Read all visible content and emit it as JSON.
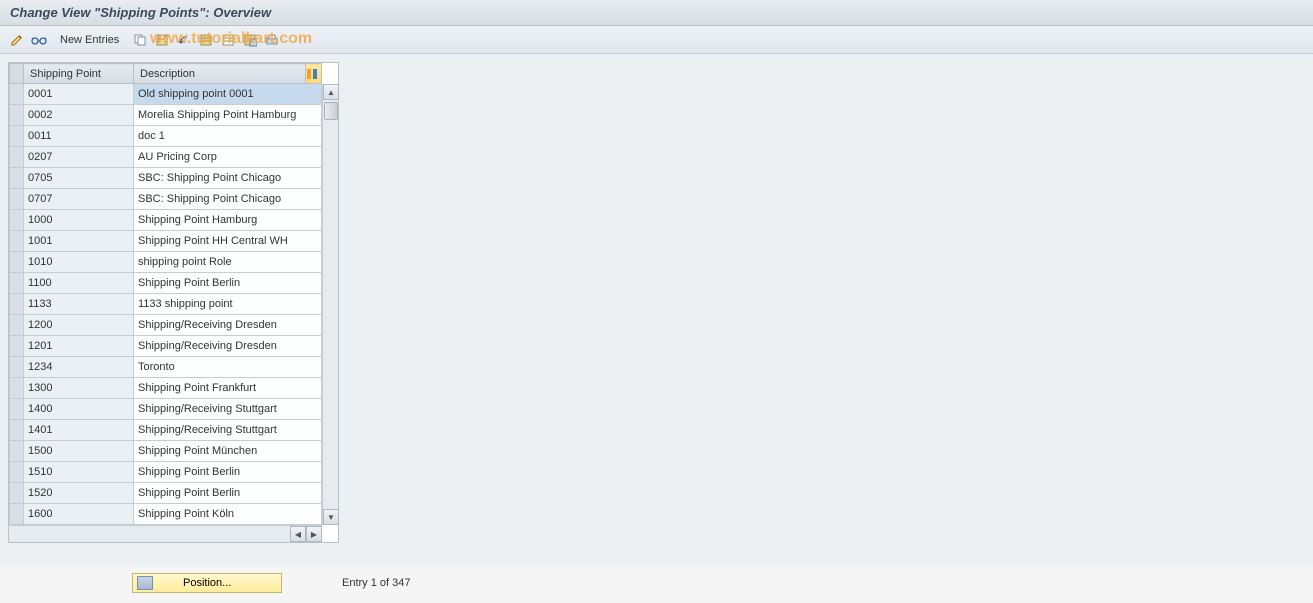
{
  "title": "Change View \"Shipping Points\": Overview",
  "toolbar": {
    "new_entries_label": "New Entries"
  },
  "watermark": "www.tutorialkart.com",
  "table": {
    "headers": {
      "shipping_point": "Shipping Point",
      "description": "Description"
    },
    "rows": [
      {
        "sp": "0001",
        "desc": "Old shipping point 0001"
      },
      {
        "sp": "0002",
        "desc": "Morelia Shipping Point Hamburg"
      },
      {
        "sp": "0011",
        "desc": "doc 1"
      },
      {
        "sp": "0207",
        "desc": "AU Pricing Corp"
      },
      {
        "sp": "0705",
        "desc": "SBC: Shipping Point Chicago"
      },
      {
        "sp": "0707",
        "desc": "SBC: Shipping Point Chicago"
      },
      {
        "sp": "1000",
        "desc": "Shipping Point Hamburg"
      },
      {
        "sp": "1001",
        "desc": "Shipping Point HH Central WH"
      },
      {
        "sp": "1010",
        "desc": "shipping point Role"
      },
      {
        "sp": "1100",
        "desc": "Shipping Point Berlin"
      },
      {
        "sp": "1133",
        "desc": "1133 shipping point"
      },
      {
        "sp": "1200",
        "desc": "Shipping/Receiving Dresden"
      },
      {
        "sp": "1201",
        "desc": "Shipping/Receiving Dresden"
      },
      {
        "sp": "1234",
        "desc": "Toronto"
      },
      {
        "sp": "1300",
        "desc": "Shipping Point Frankfurt"
      },
      {
        "sp": "1400",
        "desc": "Shipping/Receiving Stuttgart"
      },
      {
        "sp": "1401",
        "desc": "Shipping/Receiving Stuttgart"
      },
      {
        "sp": "1500",
        "desc": "Shipping Point München"
      },
      {
        "sp": "1510",
        "desc": "Shipping Point Berlin"
      },
      {
        "sp": "1520",
        "desc": "Shipping Point Berlin"
      },
      {
        "sp": "1600",
        "desc": "Shipping Point Köln"
      }
    ]
  },
  "footer": {
    "position_label": "Position...",
    "entry_status": "Entry 1 of 347"
  }
}
